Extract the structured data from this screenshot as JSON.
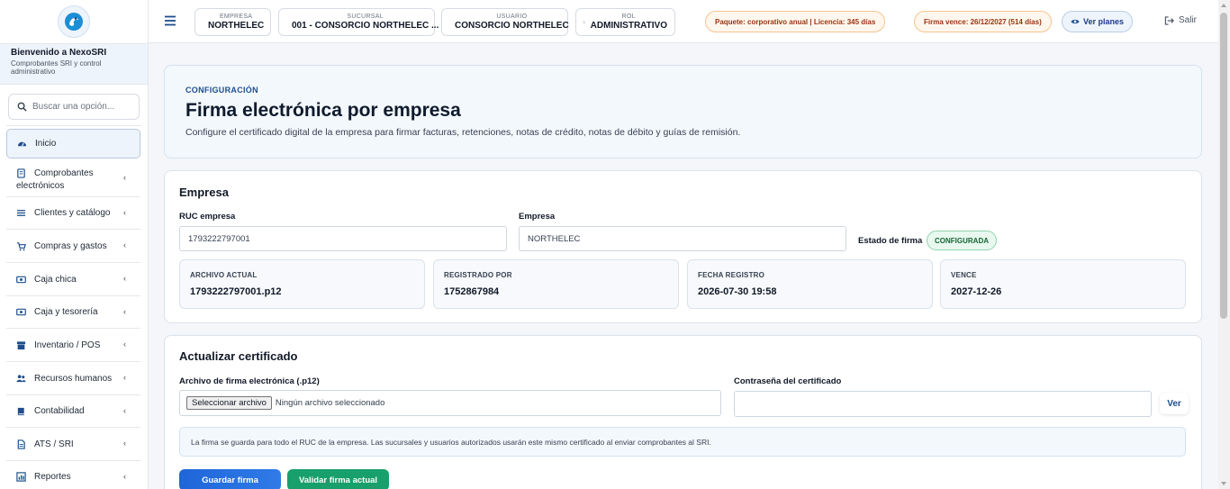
{
  "sidebar": {
    "welcome_title": "Bienvenido a NexoSRI",
    "welcome_sub_1": "Comprobantes SRI y control",
    "welcome_sub_2": "administrativo",
    "search_placeholder": "Buscar una opción...",
    "items": [
      {
        "label": "Inicio",
        "icon": "dashboard-icon"
      },
      {
        "label": "Comprobantes",
        "label2": "electrónicos",
        "icon": "document-icon"
      },
      {
        "label": "Clientes y catálogo",
        "icon": "list-icon"
      },
      {
        "label": "Compras y gastos",
        "icon": "cart-icon"
      },
      {
        "label": "Caja chica",
        "icon": "cash-icon"
      },
      {
        "label": "Caja y tesorería",
        "icon": "cash-icon"
      },
      {
        "label": "Inventario / POS",
        "icon": "box-icon"
      },
      {
        "label": "Recursos humanos",
        "icon": "users-icon"
      },
      {
        "label": "Contabilidad",
        "icon": "book-icon"
      },
      {
        "label": "ATS / SRI",
        "icon": "file-icon"
      },
      {
        "label": "Reportes",
        "icon": "chart-icon"
      }
    ]
  },
  "topbar": {
    "empresa_label": "EMPRESA",
    "empresa_value": "NORTHELEC",
    "sucursal_label": "SUCURSAL",
    "sucursal_value": "001 - CONSORCIO NORTHELEC ...",
    "usuario_label": "USUARIO",
    "usuario_value": "CONSORCIO NORTHELEC",
    "rol_label": "ROL",
    "rol_value": "ADMINISTRATIVO",
    "package_badge": "Paquete: corporativo anual | Licencia: 345 días",
    "signature_badge": "Firma vence: 26/12/2027 (514 días)",
    "plans_label": "Ver planes",
    "exit_label": "Salir"
  },
  "hero": {
    "kicker": "CONFIGURACIÓN",
    "title": "Firma electrónica por empresa",
    "description": "Configure el certificado digital de la empresa para firmar facturas, retenciones, notas de crédito, notas de débito y guías de remisión."
  },
  "empresa": {
    "title": "Empresa",
    "ruc_label": "RUC empresa",
    "ruc_value": "1793222797001",
    "empresa_label": "Empresa",
    "empresa_value": "NORTHELEC",
    "estado_label": "Estado de firma",
    "estado_value": "CONFIGURADA",
    "info": [
      {
        "label": "ARCHIVO ACTUAL",
        "value": "1793222797001.p12"
      },
      {
        "label": "REGISTRADO POR",
        "value": "1752867984"
      },
      {
        "label": "FECHA REGISTRO",
        "value": "2026-07-30 19:58"
      },
      {
        "label": "VENCE",
        "value": "2027-12-26"
      }
    ]
  },
  "update": {
    "title": "Actualizar certificado",
    "file_label": "Archivo de firma electrónica (.p12)",
    "file_button": "Seleccionar archivo",
    "file_none": "Ningún archivo seleccionado",
    "password_label": "Contraseña del certificado",
    "password_value": "",
    "show_button": "Ver",
    "note": "La firma se guarda para todo el RUC de la empresa. Las sucursales y usuarios autorizados usarán este mismo certificado al enviar comprobantes al SRI.",
    "save_button": "Guardar firma",
    "validate_button": "Validar firma actual"
  },
  "colors": {
    "primary": "#1e66d9",
    "success": "#17a06b",
    "accent_orange": "#9a3412"
  }
}
